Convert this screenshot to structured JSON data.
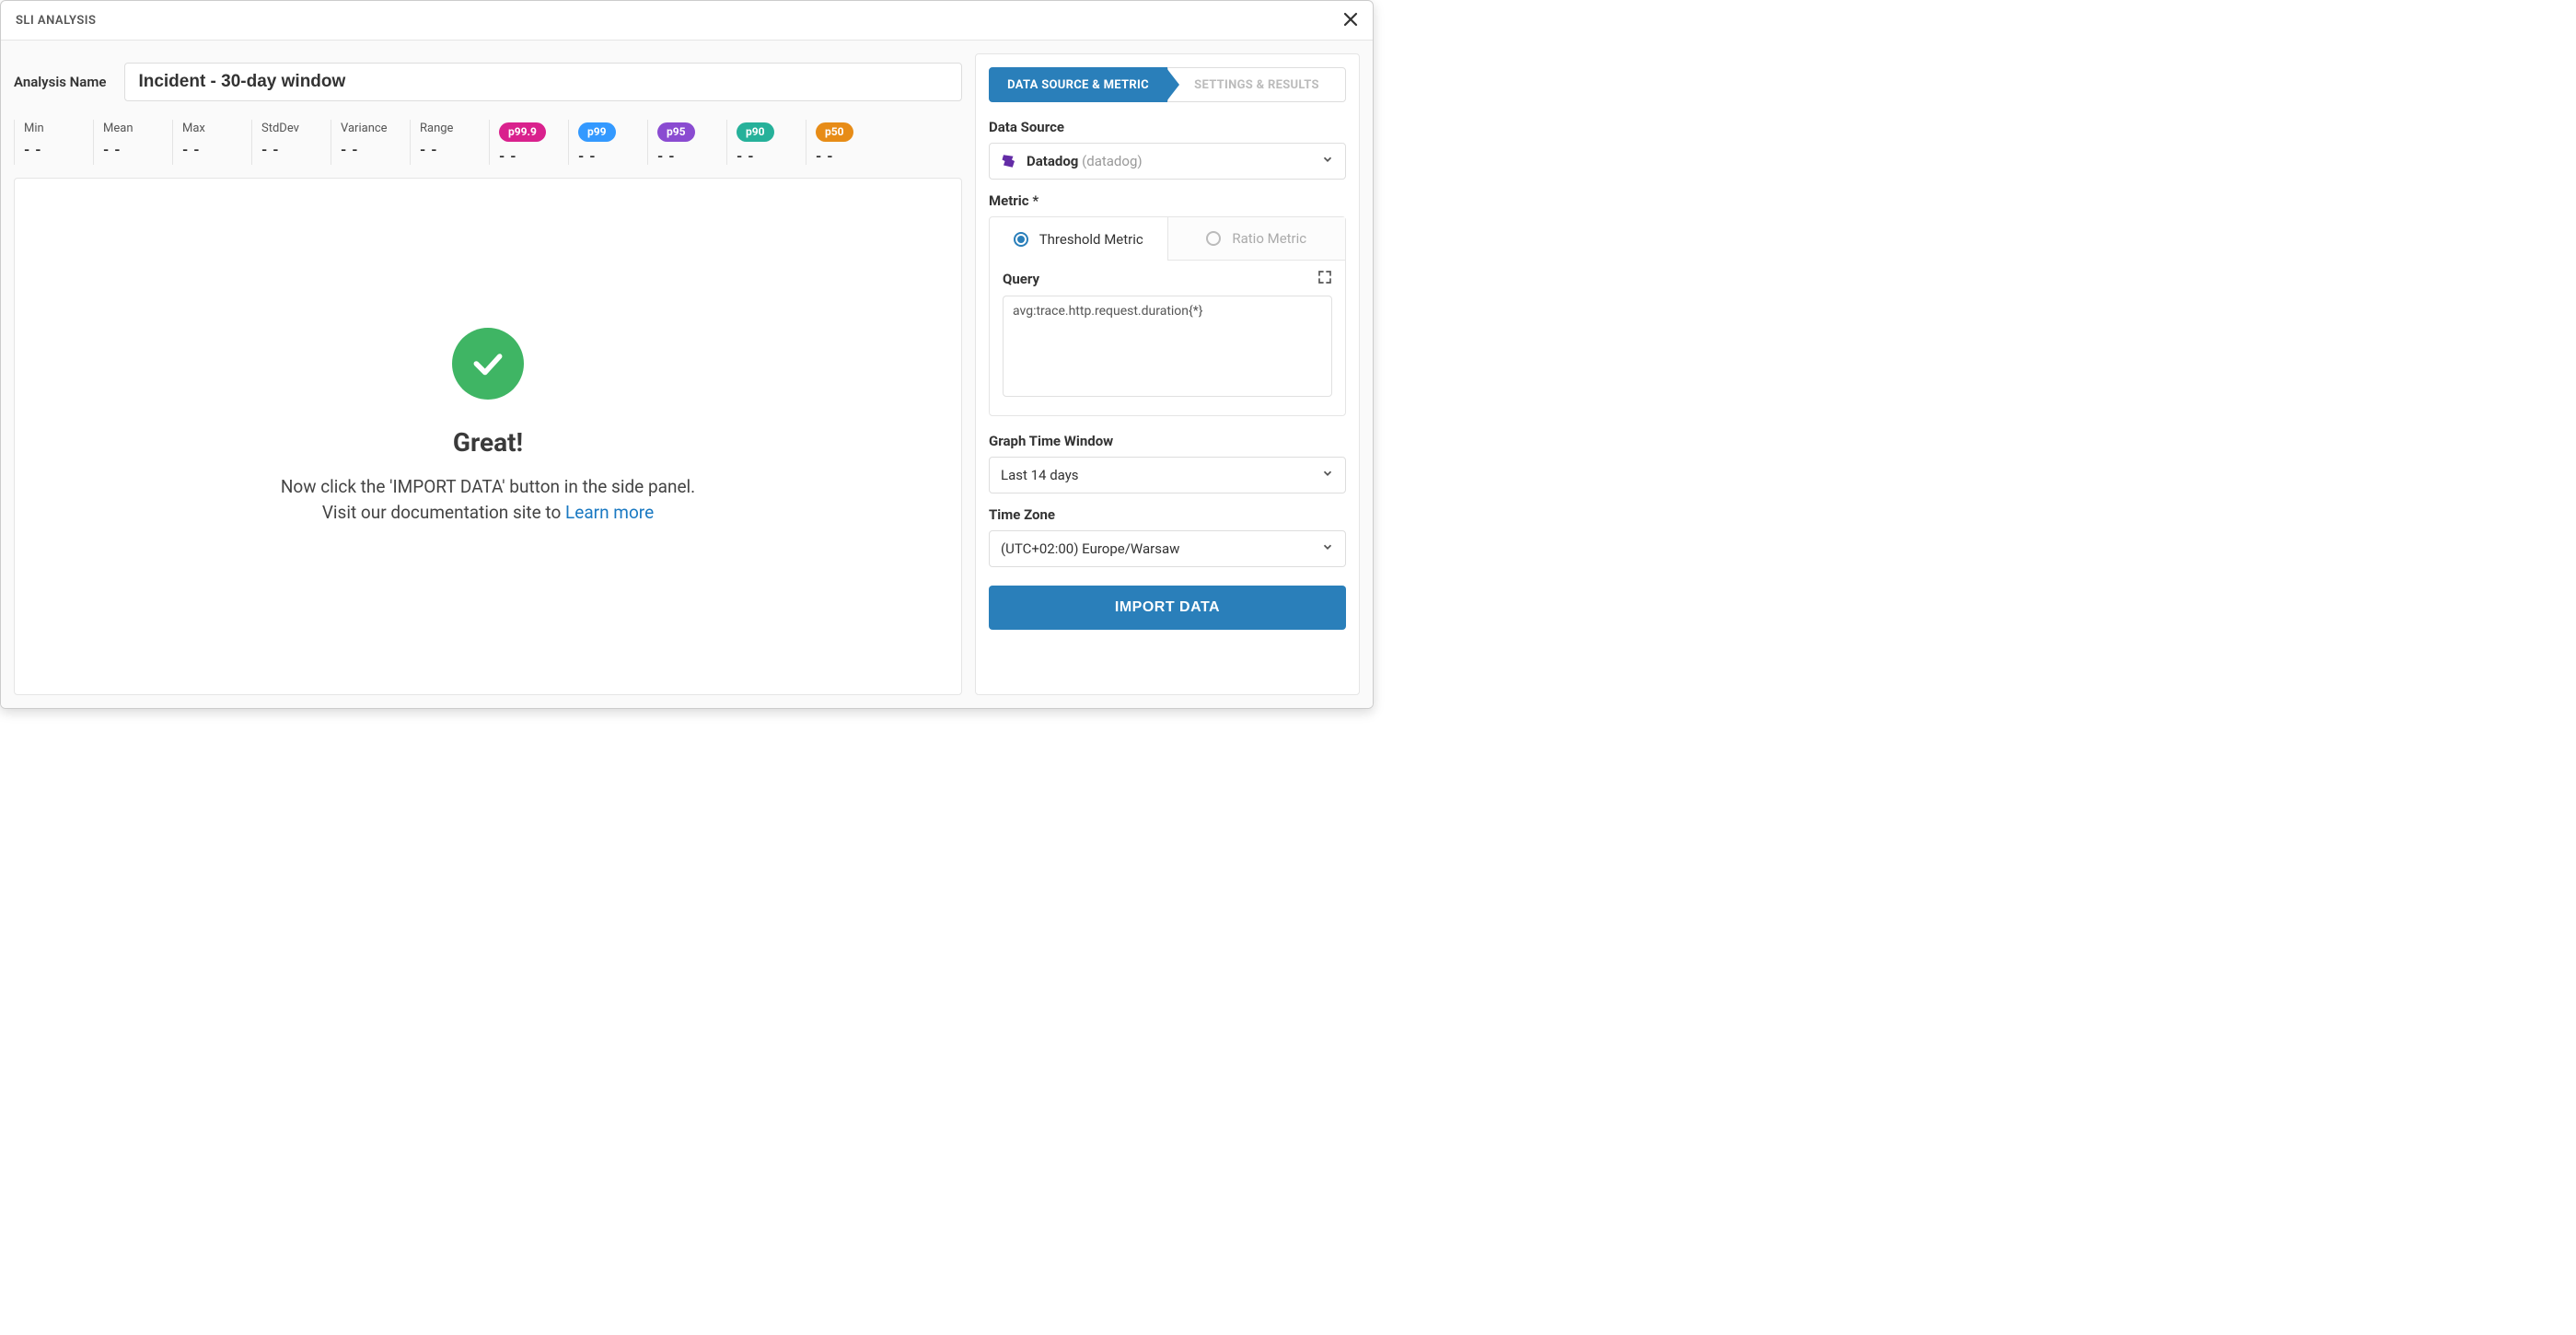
{
  "header": {
    "title": "SLI ANALYSIS"
  },
  "analysis": {
    "name_label": "Analysis Name",
    "name_value": "Incident - 30-day window"
  },
  "stats": [
    {
      "label": "Min",
      "value": "- -"
    },
    {
      "label": "Mean",
      "value": "- -"
    },
    {
      "label": "Max",
      "value": "- -"
    },
    {
      "label": "StdDev",
      "value": "- -"
    },
    {
      "label": "Variance",
      "value": "- -"
    },
    {
      "label": "Range",
      "value": "- -"
    }
  ],
  "percentiles": [
    {
      "label": "p99.9",
      "value": "- -",
      "class": "pill-p999"
    },
    {
      "label": "p99",
      "value": "- -",
      "class": "pill-p99"
    },
    {
      "label": "p95",
      "value": "- -",
      "class": "pill-p95"
    },
    {
      "label": "p90",
      "value": "- -",
      "class": "pill-p90"
    },
    {
      "label": "p50",
      "value": "- -",
      "class": "pill-p50"
    }
  ],
  "empty_state": {
    "heading": "Great!",
    "line1": "Now click the 'IMPORT DATA' button in the side panel.",
    "line2_prefix": "Visit our documentation site to ",
    "learn_more": "Learn more"
  },
  "side": {
    "tabs": {
      "data_source_metric": "DATA SOURCE & METRIC",
      "settings_results": "SETTINGS & RESULTS"
    },
    "data_source_label": "Data Source",
    "data_source_value": "Datadog",
    "data_source_sub": "(datadog)",
    "metric_label": "Metric *",
    "metric_tabs": {
      "threshold": "Threshold Metric",
      "ratio": "Ratio Metric"
    },
    "query_label": "Query",
    "query_value": "avg:trace.http.request.duration{*}",
    "graph_window_label": "Graph Time Window",
    "graph_window_value": "Last 14 days",
    "timezone_label": "Time Zone",
    "timezone_value": "(UTC+02:00) Europe/Warsaw",
    "import_button": "IMPORT DATA"
  }
}
